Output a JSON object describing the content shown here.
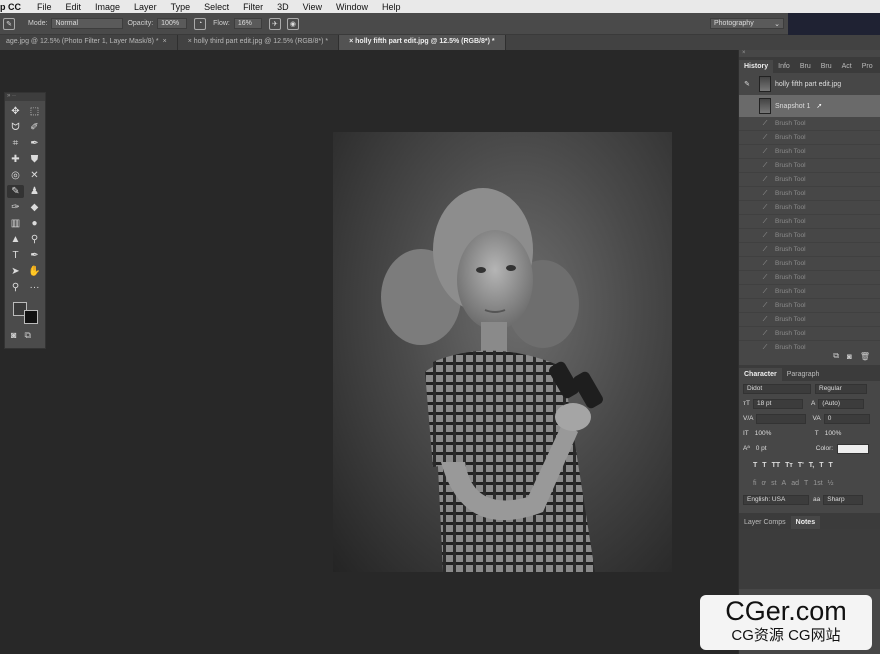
{
  "menubar": {
    "app": "p CC",
    "items": [
      "File",
      "Edit",
      "Image",
      "Layer",
      "Type",
      "Select",
      "Filter",
      "3D",
      "View",
      "Window",
      "Help"
    ]
  },
  "options": {
    "mode_label": "Mode:",
    "mode_value": "Normal",
    "opacity_label": "Opacity:",
    "opacity_value": "100%",
    "flow_label": "Flow:",
    "flow_value": "16%",
    "workspace": "Photography"
  },
  "tabs": [
    {
      "label": "age.jpg @ 12.5% (Photo Filter 1, Layer Mask/8) *"
    },
    {
      "label": "holly third part edit.jpg @ 12.5% (RGB/8*) *"
    },
    {
      "label": "holly fifth part edit.jpg @ 12.5% (RGB/8*) *"
    }
  ],
  "history": {
    "tabs": [
      "History",
      "Info",
      "Bru",
      "Bru",
      "Act",
      "Pro"
    ],
    "document": "holly fifth part edit.jpg",
    "snapshot": "Snapshot 1",
    "step_label": "Brush Tool",
    "steps": 18
  },
  "character": {
    "tabs": [
      "Character",
      "Paragraph"
    ],
    "font_family": "Didot",
    "font_style": "Regular",
    "size": "18 pt",
    "leading": "(Auto)",
    "kerning": "",
    "tracking": "0",
    "vscale": "100%",
    "hscale": "100%",
    "baseline": "0 pt",
    "color_label": "Color:",
    "type_buttons": [
      "T",
      "T",
      "TT",
      "Tт",
      "T'",
      "T,",
      "T",
      "T"
    ],
    "ot_buttons": [
      "fi",
      "ơ",
      "st",
      "A",
      "ad",
      "T",
      "1st",
      "½"
    ],
    "language": "English: USA",
    "antialias": "Sharp"
  },
  "bottom_tabs": [
    "Layer Comps",
    "Notes"
  ],
  "watermark": {
    "big": "CGer.com",
    "small": "CG资源 CG网站"
  }
}
